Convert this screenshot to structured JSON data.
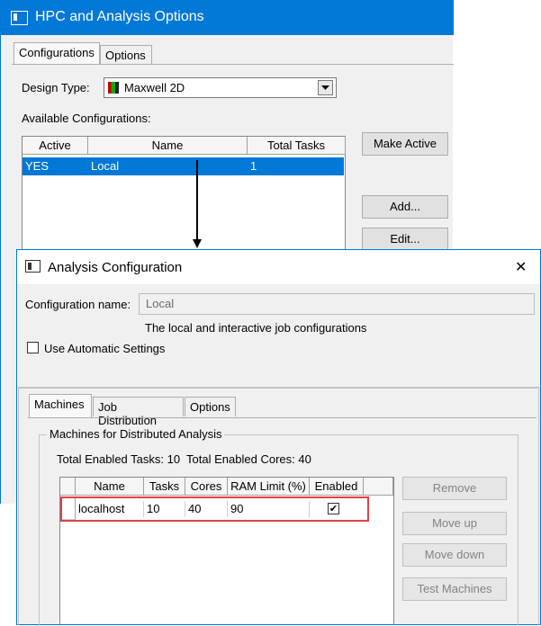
{
  "hpc": {
    "title": "HPC and Analysis Options",
    "tabs": [
      "Configurations",
      "Options"
    ],
    "design_type_label": "Design Type:",
    "design_type_value": "Maxwell 2D",
    "available_label": "Available Configurations:",
    "columns": [
      "Active",
      "Name",
      "Total Tasks"
    ],
    "row": {
      "active": "YES",
      "name": "Local",
      "tasks": "1"
    },
    "buttons": {
      "make_active": "Make Active",
      "add": "Add...",
      "edit": "Edit..."
    }
  },
  "analysis": {
    "title": "Analysis Configuration",
    "config_name_label": "Configuration name:",
    "config_name_value": "Local",
    "description": "The local and interactive job configurations",
    "auto_settings_label": "Use Automatic Settings",
    "tabs": [
      "Machines",
      "Job Distribution",
      "Options"
    ],
    "group_label": "Machines for Distributed Analysis",
    "totals": "Total Enabled Tasks: 10  Total Enabled Cores: 40",
    "columns": [
      "Name",
      "Tasks",
      "Cores",
      "RAM Limit (%)",
      "Enabled"
    ],
    "row": {
      "name": "localhost",
      "tasks": "10",
      "cores": "40",
      "ram": "90",
      "enabled_mark": "✔"
    },
    "buttons": {
      "remove": "Remove",
      "move_up": "Move up",
      "move_down": "Move down",
      "test": "Test Machines"
    },
    "close_glyph": "✕"
  },
  "colors": {
    "titlebar_blue": "#0078d7",
    "selection_blue": "#0078d7",
    "highlight_red": "#e0404a"
  }
}
